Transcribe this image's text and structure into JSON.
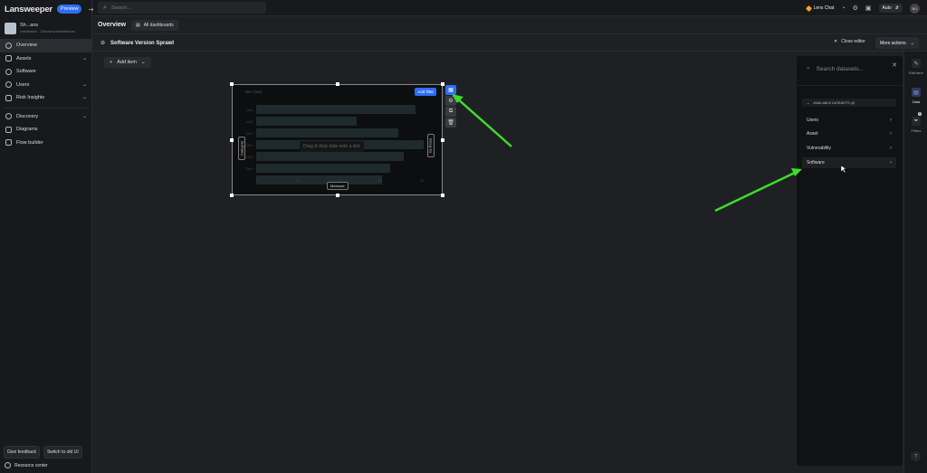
{
  "sidebar": {
    "logo": "Lansweeper",
    "preview_badge": "Preview",
    "org_name": "Sh...ans",
    "org_sub": "Installation - Directory/Installations",
    "items": [
      {
        "label": "Overview",
        "icon": "overview-icon"
      },
      {
        "label": "Assets",
        "icon": "monitor-icon",
        "chevron": true
      },
      {
        "label": "Software",
        "icon": "software-icon"
      },
      {
        "label": "Users",
        "icon": "user-icon",
        "chevron": true
      },
      {
        "label": "Risk Insights",
        "icon": "shield-icon",
        "chevron": true
      },
      {
        "label": "Discovery",
        "icon": "radar-icon",
        "chevron": true
      },
      {
        "label": "Diagrams",
        "icon": "diagram-icon"
      },
      {
        "label": "Flow builder",
        "icon": "flow-icon"
      }
    ],
    "give_feedback": "Give feedback",
    "switch_old": "Switch to old UI",
    "resource_center": "Resource center"
  },
  "topbar": {
    "search_placeholder": "Search...",
    "lens_chat": "Lens Chat",
    "theme": "Auto",
    "avatar": "BG"
  },
  "overview": {
    "title": "Overview",
    "all_dashboards": "All dashboards"
  },
  "editor": {
    "title": "Software Version Sprawl",
    "close_editor": "Close editor",
    "more_actions": "More actions"
  },
  "canvas": {
    "add_item": "Add item",
    "widget": {
      "title": "Bar chart",
      "add_filter": "Add filter",
      "drop_note": "Drag & drop data onto a slot",
      "category": "Category",
      "group_by": "Group by",
      "measure": "Measure",
      "ylabels": [
        "Cat A",
        "Cat B",
        "Cat C",
        "Cat D",
        "Cat E",
        "Cat F"
      ],
      "xticks": [
        "0",
        "10",
        "20",
        "30",
        "40"
      ],
      "placeholder_bars": [
        0.95,
        0.6,
        0.85,
        1.0,
        0.88,
        0.8,
        0.75
      ]
    }
  },
  "datasets": {
    "search_placeholder": "Search datasets...",
    "header": "AVAILABLE DATASETS (4)",
    "items": [
      "Users",
      "Asset",
      "Vulnerability",
      "Software"
    ]
  },
  "rail": {
    "edit_item": "Edit item",
    "data": "Data",
    "filters": "Filters",
    "filter_count": "0",
    "help": "?"
  },
  "colors": {
    "accent": "#2d6ef5",
    "annotation_arrow": "#3ddc2a"
  }
}
